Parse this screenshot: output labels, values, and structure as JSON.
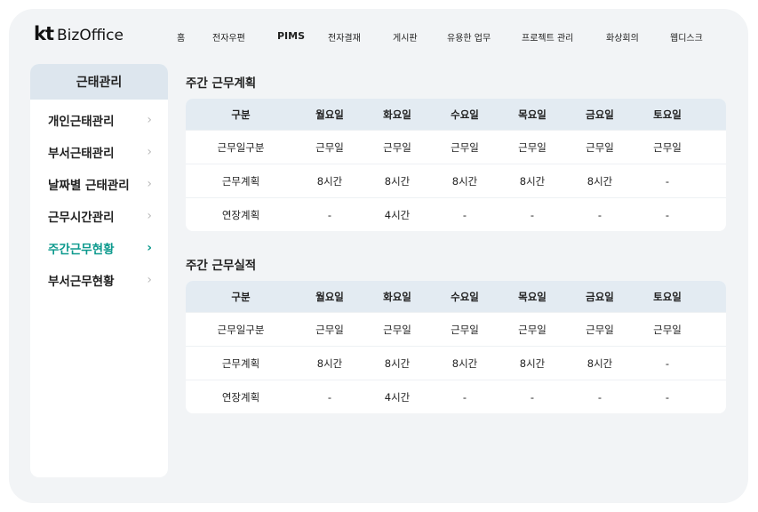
{
  "app": {
    "logo_kt": "kt",
    "logo_name": "BizOffice"
  },
  "nav": [
    "홈",
    "전자우편",
    "PIMS",
    "전자결재",
    "게시판",
    "유용한 업무",
    "프로젝트 관리",
    "화상회의",
    "웹디스크"
  ],
  "sidebar": {
    "title": "근태관리",
    "items": [
      {
        "label": "개인근태관리"
      },
      {
        "label": "부서근태관리"
      },
      {
        "label": "날짜별 근태관리"
      },
      {
        "label": "근무시간관리"
      },
      {
        "label": "주간근무현황",
        "active": true
      },
      {
        "label": "부서근무현황"
      }
    ]
  },
  "accent_color": "#0e9a8e",
  "plan": {
    "title": "주간 근무계획",
    "headers": [
      "구분",
      "월요일",
      "화요일",
      "수요일",
      "목요일",
      "금요일",
      "토요일"
    ],
    "rows": [
      [
        "근무일구분",
        "근무일",
        "근무일",
        "근무일",
        "근무일",
        "근무일",
        "근무일"
      ],
      [
        "근무계획",
        "8시간",
        "8시간",
        "8시간",
        "8시간",
        "8시간",
        "-"
      ],
      [
        "연장계획",
        "-",
        "4시간",
        "-",
        "-",
        "-",
        "-"
      ]
    ]
  },
  "actual": {
    "title": "주간 근무실적",
    "headers": [
      "구분",
      "월요일",
      "화요일",
      "수요일",
      "목요일",
      "금요일",
      "토요일"
    ],
    "rows": [
      [
        "근무일구분",
        "근무일",
        "근무일",
        "근무일",
        "근무일",
        "근무일",
        "근무일"
      ],
      [
        "근무계획",
        "8시간",
        "8시간",
        "8시간",
        "8시간",
        "8시간",
        "-"
      ],
      [
        "연장계획",
        "-",
        "4시간",
        "-",
        "-",
        "-",
        "-"
      ]
    ]
  }
}
